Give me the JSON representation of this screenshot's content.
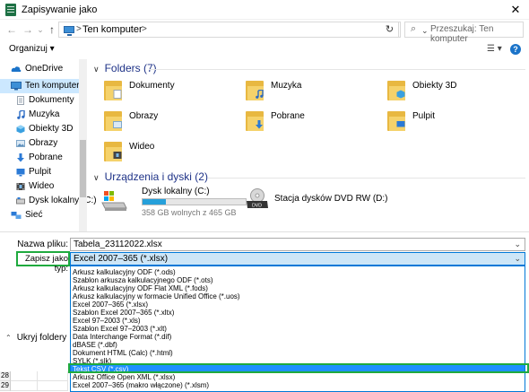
{
  "window": {
    "title": "Zapisywanie jako",
    "close_glyph": "✕"
  },
  "nav": {
    "back": "←",
    "forward": "→",
    "dropdown": "⌄",
    "up": "↑"
  },
  "address": {
    "crumb": "Ten komputer",
    "sep": ">",
    "dropdown": "⌄",
    "refresh": "↻"
  },
  "search": {
    "placeholder": "Przeszukaj: Ten komputer",
    "icon": "⌕"
  },
  "toolbar": {
    "organize": "Organizuj ▾",
    "view": "☰ ▾",
    "help": "?"
  },
  "sidebar": {
    "items": [
      {
        "label": "OneDrive",
        "icon": "cloud-icon",
        "color": "#1a73c9"
      },
      {
        "label": "Ten komputer",
        "icon": "computer-icon",
        "color": "#3c8fd6",
        "selected": true
      },
      {
        "label": "Dokumenty",
        "icon": "documents-icon",
        "color": "#9aa5b1"
      },
      {
        "label": "Muzyka",
        "icon": "music-icon",
        "color": "#2c6bc4"
      },
      {
        "label": "Obiekty 3D",
        "icon": "cube-icon",
        "color": "#3aa0e0"
      },
      {
        "label": "Obrazy",
        "icon": "pictures-icon",
        "color": "#7fa7c9"
      },
      {
        "label": "Pobrane",
        "icon": "download-icon",
        "color": "#2b7ad6"
      },
      {
        "label": "Pulpit",
        "icon": "desktop-icon",
        "color": "#2b7ad6"
      },
      {
        "label": "Wideo",
        "icon": "video-icon",
        "color": "#555555"
      },
      {
        "label": "Dysk lokalny (C:)",
        "icon": "drive-icon",
        "color": "#7d7d7d"
      },
      {
        "label": "Sieć",
        "icon": "network-icon",
        "color": "#2b7ad6"
      }
    ]
  },
  "main": {
    "folders_header": "Folders (7)",
    "folders": [
      {
        "label": "Dokumenty",
        "badge": "documents-badge-icon",
        "color": "#d0d6dc"
      },
      {
        "label": "Muzyka",
        "badge": "music-badge-icon",
        "color": "#2c6bc4"
      },
      {
        "label": "Obiekty 3D",
        "badge": "cube-badge-icon",
        "color": "#3aa0e0"
      },
      {
        "label": "Obrazy",
        "badge": "pictures-badge-icon",
        "color": "#9cc3e2"
      },
      {
        "label": "Pobrane",
        "badge": "download-badge-icon",
        "color": "#2b7ad6"
      },
      {
        "label": "Pulpit",
        "badge": "desktop-badge-icon",
        "color": "#2b7ad6"
      },
      {
        "label": "Wideo",
        "badge": "film-badge-icon",
        "color": "#444444"
      }
    ],
    "drives_header": "Urządzenia i dyski (2)",
    "drives": [
      {
        "label": "Dysk lokalny (C:)",
        "sub": "358 GB wolnych z 465 GB",
        "used_fraction": 0.23,
        "icon": "hdd-icon"
      },
      {
        "label": "Stacja dysków DVD RW (D:)",
        "icon": "dvd-drive-icon",
        "badge": "DVD"
      }
    ]
  },
  "form": {
    "filename_label": "Nazwa pliku:",
    "filename_value": "Tabela_23112022.xlsx",
    "filetype_label": "Zapisz jako typ:",
    "filetype_value": "Excel 2007–365 (*.xlsx)",
    "dd_arrow": "⌄"
  },
  "filetype_options": [
    "Arkusz kalkulacyjny ODF (*.ods)",
    "Szablon arkusza kalkulacyjnego ODF (*.ots)",
    "Arkusz kalkulacyjny ODF Flat XML (*.fods)",
    "Arkusz kalkulacyjny w formacie Unified Office (*.uos)",
    "Excel 2007–365 (*.xlsx)",
    "Szablon Excel 2007–365 (*.xltx)",
    "Excel 97–2003 (*.xls)",
    "Szablon Excel 97–2003 (*.xlt)",
    "Data Interchange Format (*.dif)",
    "dBASE (*.dbf)",
    "Dokument HTML (Calc) (*.html)",
    "SYLK (*.slk)",
    "Tekst CSV (*.csv)",
    "Arkusz Office Open XML (*.xlsx)",
    "Excel 2007–365 (makro włączone) (*.xlsm)"
  ],
  "highlighted_option_index": 12,
  "hide_folders": {
    "chev": "⌃",
    "label": "Ukryj foldery"
  },
  "sheet_rows": [
    "28",
    "29"
  ]
}
